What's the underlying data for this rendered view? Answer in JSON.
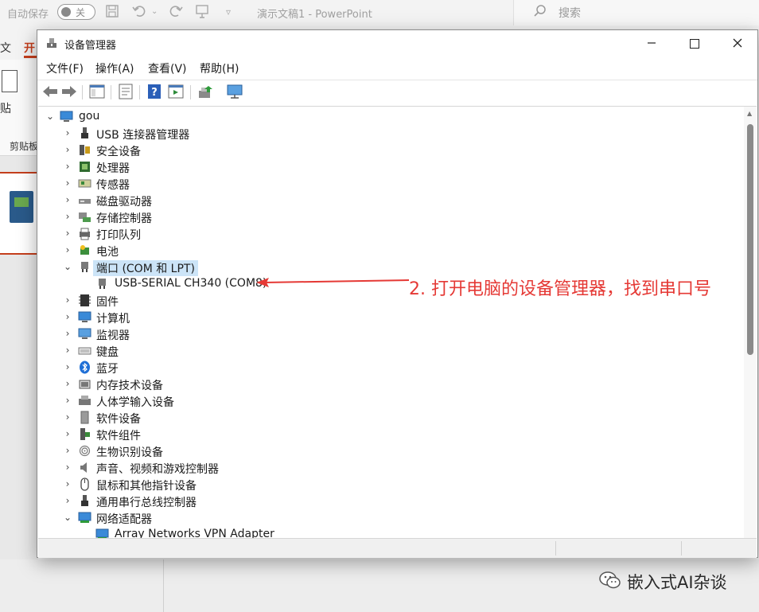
{
  "ppt": {
    "autosave_label": "自动保存",
    "autosave_state": "关",
    "doc_title": "演示文稿1 - PowerPoint",
    "search_placeholder": "搜索",
    "file_tab": "文",
    "home_tab": "开",
    "paste_label": "贴",
    "clipboard_label": "剪贴板"
  },
  "device_manager": {
    "title": "设备管理器",
    "menu": [
      "文件(F)",
      "操作(A)",
      "查看(V)",
      "帮助(H)"
    ],
    "toolbar_icons": [
      "back-arrow-icon",
      "forward-arrow-icon",
      "show-hide-tree-icon",
      "properties-icon",
      "help-icon",
      "action-pane-icon",
      "update-driver-icon",
      "scan-hardware-icon"
    ],
    "root": {
      "label": "gou",
      "expanded": true
    },
    "tree": [
      {
        "label": "USB 连接器管理器",
        "icon": "usb-connector-icon",
        "expanded": false
      },
      {
        "label": "安全设备",
        "icon": "security-device-icon",
        "expanded": false
      },
      {
        "label": "处理器",
        "icon": "processor-icon",
        "expanded": false
      },
      {
        "label": "传感器",
        "icon": "sensor-icon",
        "expanded": false
      },
      {
        "label": "磁盘驱动器",
        "icon": "disk-drive-icon",
        "expanded": false
      },
      {
        "label": "存储控制器",
        "icon": "storage-controller-icon",
        "expanded": false
      },
      {
        "label": "打印队列",
        "icon": "printer-icon",
        "expanded": false
      },
      {
        "label": "电池",
        "icon": "battery-icon",
        "expanded": false
      },
      {
        "label": "端口 (COM 和 LPT)",
        "icon": "port-icon",
        "expanded": true,
        "selected": true
      },
      {
        "label": "USB-SERIAL CH340 (COM8)",
        "icon": "port-icon",
        "child": true
      },
      {
        "label": "固件",
        "icon": "firmware-icon",
        "expanded": false
      },
      {
        "label": "计算机",
        "icon": "computer-icon",
        "expanded": false
      },
      {
        "label": "监视器",
        "icon": "monitor-icon",
        "expanded": false
      },
      {
        "label": "键盘",
        "icon": "keyboard-icon",
        "expanded": false
      },
      {
        "label": "蓝牙",
        "icon": "bluetooth-icon",
        "expanded": false
      },
      {
        "label": "内存技术设备",
        "icon": "memory-device-icon",
        "expanded": false
      },
      {
        "label": "人体学输入设备",
        "icon": "hid-icon",
        "expanded": false
      },
      {
        "label": "软件设备",
        "icon": "software-device-icon",
        "expanded": false
      },
      {
        "label": "软件组件",
        "icon": "software-component-icon",
        "expanded": false
      },
      {
        "label": "生物识别设备",
        "icon": "fingerprint-icon",
        "expanded": false
      },
      {
        "label": "声音、视频和游戏控制器",
        "icon": "speaker-icon",
        "expanded": false
      },
      {
        "label": "鼠标和其他指针设备",
        "icon": "mouse-icon",
        "expanded": false
      },
      {
        "label": "通用串行总线控制器",
        "icon": "usb-controller-icon",
        "expanded": false
      },
      {
        "label": "网络适配器",
        "icon": "network-adapter-icon",
        "expanded": true
      },
      {
        "label": "Array Networks VPN Adapter",
        "icon": "network-adapter-icon",
        "child": true
      }
    ]
  },
  "annotation": {
    "text": "2. 打开电脑的设备管理器，找到串口号",
    "color": "#e53935"
  },
  "watermark": {
    "text": "嵌入式AI杂谈"
  }
}
